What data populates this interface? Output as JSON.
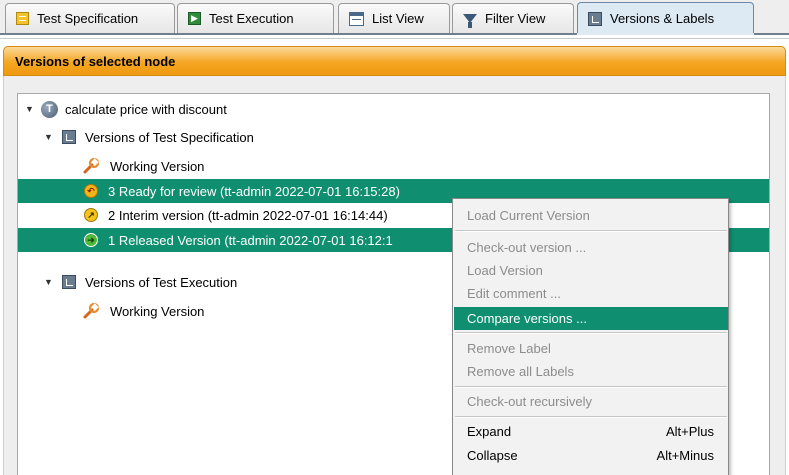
{
  "tabs": [
    {
      "label": "Test Specification",
      "icon": "test-specification-icon"
    },
    {
      "label": "Test Execution",
      "icon": "test-execution-icon"
    },
    {
      "label": "List View",
      "icon": "list-view-icon"
    },
    {
      "label": "Filter View",
      "icon": "filter-icon"
    },
    {
      "label": "Versions & Labels",
      "icon": "versions-labels-icon",
      "active": true
    }
  ],
  "panel": {
    "title": "Versions of selected node"
  },
  "tree": {
    "root": {
      "label": "calculate price with discount",
      "icon": "test-node-icon"
    },
    "spec_group": {
      "label": "Versions of Test Specification",
      "icon": "version-group-icon"
    },
    "spec_working": {
      "label": "Working Version",
      "icon": "wrench-icon"
    },
    "versions": [
      {
        "label": "3 Ready for review (tt-admin 2022-07-01 16:15:28)",
        "icon": "review-status-icon",
        "selected": true
      },
      {
        "label": "2 Interim version (tt-admin 2022-07-01 16:14:44)",
        "icon": "interim-status-icon",
        "selected": false
      },
      {
        "label": "1 Released Version (tt-admin 2022-07-01 16:12:1",
        "icon": "released-status-icon",
        "selected": true
      }
    ],
    "exec_group": {
      "label": "Versions of Test Execution",
      "icon": "version-group-icon"
    },
    "exec_working": {
      "label": "Working Version",
      "icon": "wrench-icon"
    }
  },
  "context_menu": {
    "items": [
      {
        "label": "Load Current Version",
        "enabled": false
      },
      {
        "label": "Check-out version ...",
        "enabled": false
      },
      {
        "label": "Load Version",
        "enabled": false
      },
      {
        "label": "Edit comment ...",
        "enabled": false
      },
      {
        "label": "Compare versions ...",
        "enabled": true,
        "highlighted": true
      },
      {
        "label": "Remove Label",
        "enabled": false
      },
      {
        "label": "Remove all Labels",
        "enabled": false
      },
      {
        "label": "Check-out recursively",
        "enabled": false
      },
      {
        "label": "Expand",
        "accelerator": "Alt+Plus",
        "enabled": true
      },
      {
        "label": "Collapse",
        "accelerator": "Alt+Minus",
        "enabled": true
      }
    ]
  },
  "colors": {
    "selection": "#0f8f6f",
    "header_orange": "#f5a623",
    "active_tab": "#dde9f3",
    "disabled_text": "#8c8c8c"
  }
}
